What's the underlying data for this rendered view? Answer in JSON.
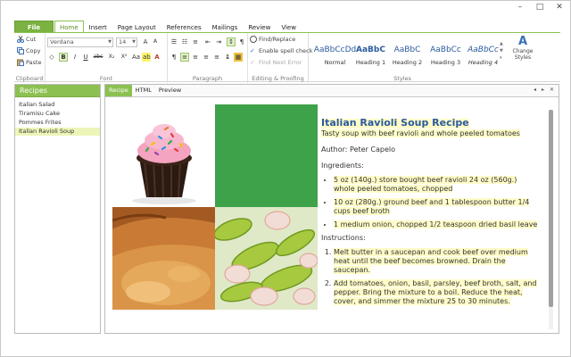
{
  "window": {
    "minimize": "–",
    "maximize": "□",
    "close": "✕"
  },
  "ribbon_tabs": [
    "File",
    "Home",
    "Insert",
    "Page Layout",
    "References",
    "Mailings",
    "Review",
    "View"
  ],
  "clipboard": {
    "cut": "Cut",
    "copy": "Copy",
    "paste": "Paste",
    "label": "Clipboard"
  },
  "font": {
    "family": "Verdana",
    "size": "14",
    "bold": "B",
    "italic": "I",
    "underline": "U",
    "strike": "abc",
    "sub": "X₂",
    "sup": "X²",
    "color_a": "A",
    "label": "Font"
  },
  "paragraph": {
    "label": "Paragraph"
  },
  "editing": {
    "find_replace": "Find/Replace",
    "spell": "Enable spell check",
    "next_error": "Find Next Error",
    "label": "Editing & Proofing"
  },
  "styles": {
    "items": [
      {
        "preview": "AaBbCcDd",
        "name": "Normal"
      },
      {
        "preview": "AaBbC",
        "name": "Heading 1"
      },
      {
        "preview": "AaBbC",
        "name": "Heading 2"
      },
      {
        "preview": "AaBbCc",
        "name": "Heading 3"
      },
      {
        "preview": "AaBbCc",
        "name": "Heading 4"
      }
    ],
    "change": "Change Styles",
    "label": "Styles"
  },
  "recipes": {
    "title": "Recipes",
    "items": [
      "Italian Salad",
      "Tiramisu Cake",
      "Pommes Frites",
      "Italian Ravioli Soup"
    ],
    "selected": 3
  },
  "doc_tabs": [
    "Recipe",
    "HTML",
    "Preview"
  ],
  "doc_controls": {
    "prev": "◂",
    "next": "▸",
    "close": "✕"
  },
  "recipe": {
    "title": "Italian Ravioli Soup Recipe",
    "subtitle": "Tasty soup with beef ravioli and whole peeled tomatoes",
    "author": "Author: Peter Capelo",
    "ingredients_label": "Ingredients:",
    "ingredients": [
      [
        "5 oz (140g.) store bought beef ravioli 24 oz (560g.)",
        "whole peeled tomatoes, chopped"
      ],
      [
        "10 oz (280g.) ground beef and 1 tablespoon butter 1/4",
        "cups beef broth"
      ],
      [
        "1 medium onion, chopped 1/2 teaspoon dried basil leave"
      ]
    ],
    "instructions_label": "Instructions:",
    "instructions": [
      [
        "Melt butter in a saucepan and cook beef over medium",
        "heat until the beef becomes browned. Drain the",
        "saucepan."
      ],
      [
        "Add tomatoes, onion, basil, parsley, beef broth, salt, and",
        "pepper. Bring the mixture to a boil. Reduce the heat,",
        "cover, and simmer the mixture 25 to 30 minutes."
      ]
    ]
  },
  "colors": {
    "accent": "#8cc152",
    "title": "#2a5a9e",
    "tile_green": "#3ea24a",
    "highlight": "#fffcc8"
  }
}
